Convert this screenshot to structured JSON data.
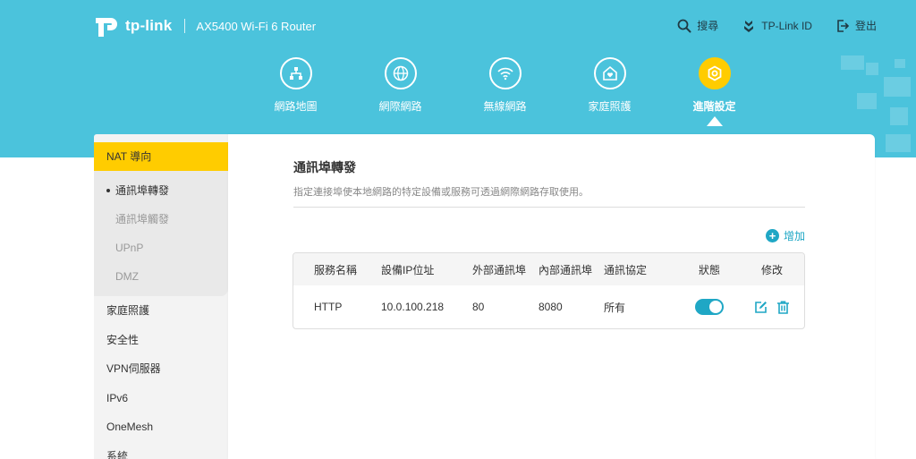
{
  "header": {
    "brand": "tp-link",
    "model": "AX5400 Wi-Fi 6 Router",
    "actions": [
      {
        "label": "搜尋",
        "icon": "search-icon"
      },
      {
        "label": "TP-Link ID",
        "icon": "user-icon"
      },
      {
        "label": "登出",
        "icon": "logout-icon"
      }
    ]
  },
  "nav": [
    {
      "label": "網路地圖",
      "icon": "network-map-icon"
    },
    {
      "label": "網際網路",
      "icon": "globe-icon"
    },
    {
      "label": "無線網路",
      "icon": "wifi-icon"
    },
    {
      "label": "家庭照護",
      "icon": "home-care-icon"
    },
    {
      "label": "進階設定",
      "icon": "gear-icon",
      "active": true
    }
  ],
  "sidebar": {
    "active_group": "NAT 導向",
    "sub_items": [
      {
        "label": "通訊埠轉發",
        "active": true
      },
      {
        "label": "通訊埠觸發"
      },
      {
        "label": "UPnP"
      },
      {
        "label": "DMZ"
      }
    ],
    "items": [
      "家庭照護",
      "安全性",
      "VPN伺服器",
      "IPv6",
      "OneMesh",
      "系統"
    ]
  },
  "content": {
    "title": "通訊埠轉發",
    "description": "指定連接埠使本地網路的特定設備或服務可透過網際網路存取使用。",
    "add_label": "增加"
  },
  "table": {
    "headers": [
      "服務名稱",
      "設備IP位址",
      "外部通訊埠",
      "內部通訊埠",
      "通訊協定",
      "狀態",
      "修改"
    ],
    "rows": [
      {
        "service": "HTTP",
        "ip": "10.0.100.218",
        "external_port": "80",
        "internal_port": "8080",
        "protocol": "所有",
        "status_on": true
      }
    ]
  },
  "colors": {
    "header_bg": "#4bc3dc",
    "accent": "#ffcc00",
    "primary": "#1fa7c5"
  }
}
